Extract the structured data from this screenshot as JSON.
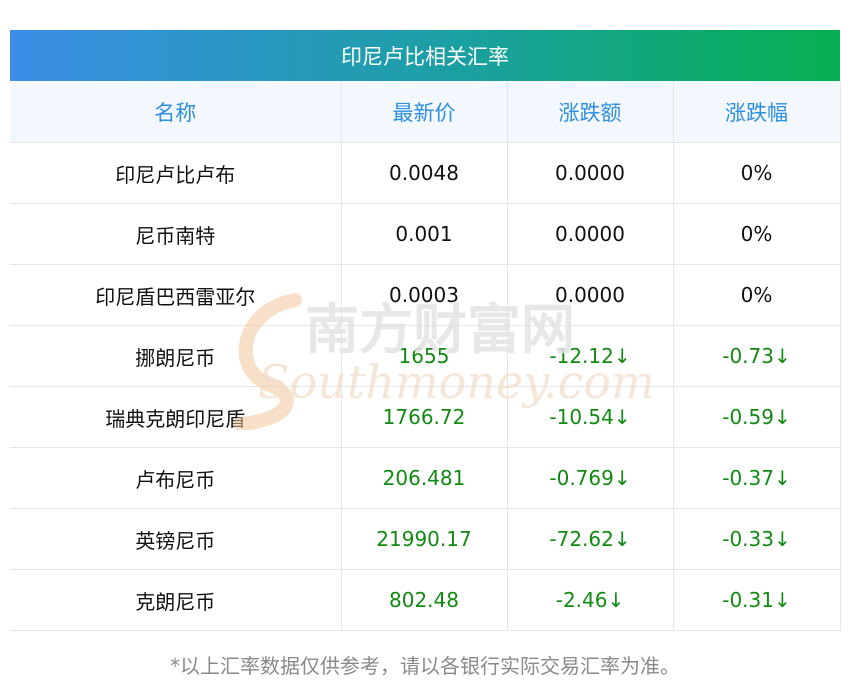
{
  "title": "印尼卢比相关汇率",
  "headers": [
    "名称",
    "最新价",
    "涨跌额",
    "涨跌幅"
  ],
  "rows": [
    {
      "name": "印尼卢比卢布",
      "price": "0.0048",
      "change": "0.0000",
      "pct": "0%",
      "dir": "flat"
    },
    {
      "name": "尼币南特",
      "price": "0.001",
      "change": "0.0000",
      "pct": "0%",
      "dir": "flat"
    },
    {
      "name": "印尼盾巴西雷亚尔",
      "price": "0.0003",
      "change": "0.0000",
      "pct": "0%",
      "dir": "flat"
    },
    {
      "name": "挪朗尼币",
      "price": "1655",
      "change": "-12.12↓",
      "pct": "-0.73↓",
      "dir": "down"
    },
    {
      "name": "瑞典克朗印尼盾",
      "price": "1766.72",
      "change": "-10.54↓",
      "pct": "-0.59↓",
      "dir": "down"
    },
    {
      "name": "卢布尼币",
      "price": "206.481",
      "change": "-0.769↓",
      "pct": "-0.37↓",
      "dir": "down"
    },
    {
      "name": "英镑尼币",
      "price": "21990.17",
      "change": "-72.62↓",
      "pct": "-0.33↓",
      "dir": "down"
    },
    {
      "name": "克朗尼币",
      "price": "802.48",
      "change": "-2.46↓",
      "pct": "-0.31↓",
      "dir": "down"
    }
  ],
  "watermark": {
    "cn": "南方财富网",
    "en": "Southmoney.com"
  },
  "footnote": "*以上汇率数据仅供参考，请以各银行实际交易汇率为准。",
  "colors": {
    "header_text": "#2f8fe0",
    "down": "#128a12",
    "title_gradient_start": "#3a8ee6",
    "title_gradient_end": "#06b050"
  }
}
